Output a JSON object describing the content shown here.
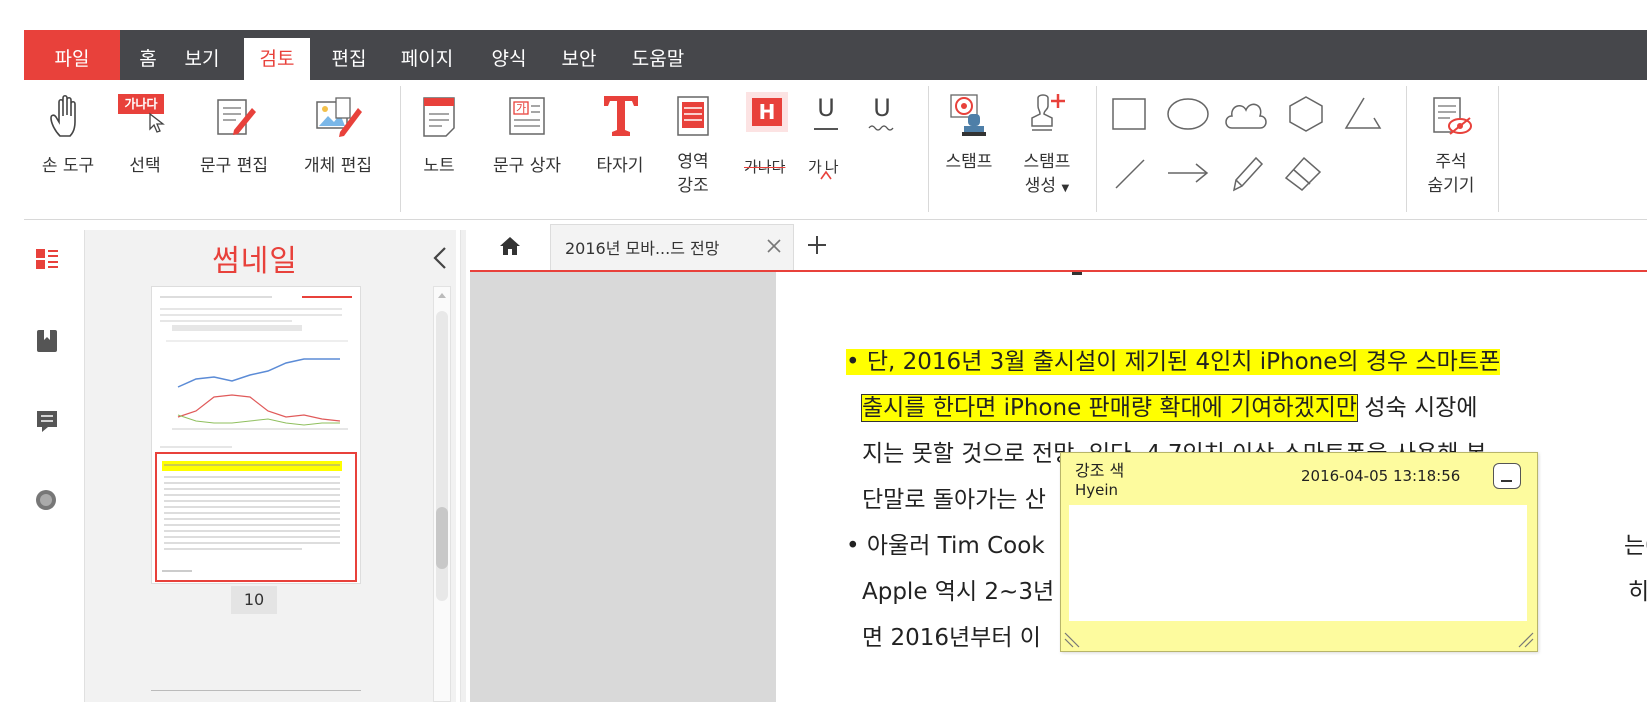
{
  "menubar": {
    "items": [
      "파일",
      "홈",
      "보기",
      "검토",
      "편집",
      "페이지",
      "양식",
      "보안",
      "도움말"
    ],
    "active": "검토"
  },
  "ribbon": {
    "hand_tool": "손 도구",
    "select_icon_text": "가나다",
    "select": "선택",
    "text_edit": "문구 편집",
    "object_edit": "개체 편집",
    "note": "노트",
    "textbox_icon_text": "가",
    "textbox": "문구 상자",
    "typewriter": "타자기",
    "area_highlight_1": "영역",
    "area_highlight_2": "강조",
    "highlight_letter": "H",
    "underline_letter": "U",
    "squiggly_letter": "U",
    "strike_text": "가나다",
    "caret_text": "가나",
    "stamp": "스탬프",
    "create_stamp_1": "스탬프",
    "create_stamp_2": "생성",
    "hide_comments_1": "주석",
    "hide_comments_2": "숨기기"
  },
  "thumbnails": {
    "title": "썸네일",
    "page_number": "10"
  },
  "tabs": {
    "doc_title": "2016년 모바...드 전망"
  },
  "document": {
    "line1": "• 단, 2016년 3월 출시설이 제기된 4인치 iPhone의 경우 스마트폰",
    "line2_hl": "출시를 한다면 iPhone 판매량 확대에 기여하겠지만",
    "line2_rest": " 성숙 시장에",
    "line3": "지는 못할 것으로 전망, 있다. 4.7인치 이상 스마트폰을 사용해 본",
    "line4": "단말로 돌아가는 산",
    "line5": "• 아울러 Tim Cook",
    "line5_end": "는0",
    "line6": "Apple 역시 2~3년",
    "line6_end": "히",
    "line7": "면 2016년부터 이"
  },
  "note": {
    "title": "강조 색",
    "author": "Hyein",
    "date": "2016-04-05 13:18:56"
  },
  "colors": {
    "accent": "#e8413b",
    "menubar": "#46474b",
    "highlight": "#ffff00",
    "note_bg": "#fdfb9e"
  }
}
